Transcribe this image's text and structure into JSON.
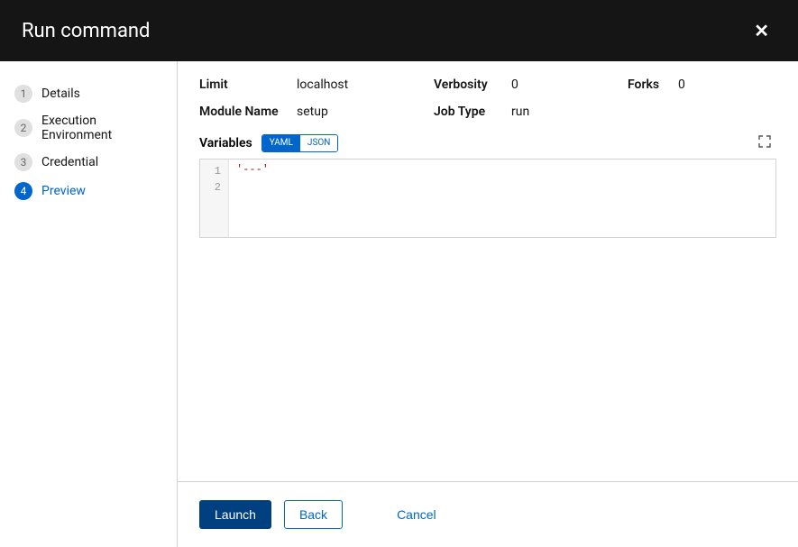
{
  "header": {
    "title": "Run command"
  },
  "steps": [
    {
      "num": "1",
      "label": "Details"
    },
    {
      "num": "2",
      "label": "Execution Environment"
    },
    {
      "num": "3",
      "label": "Credential"
    },
    {
      "num": "4",
      "label": "Preview"
    }
  ],
  "details": {
    "limit_label": "Limit",
    "limit_value": "localhost",
    "verbosity_label": "Verbosity",
    "verbosity_value": "0",
    "forks_label": "Forks",
    "forks_value": "0",
    "module_label": "Module Name",
    "module_value": "setup",
    "jobtype_label": "Job Type",
    "jobtype_value": "run"
  },
  "variables": {
    "label": "Variables",
    "toggle_yaml": "YAML",
    "toggle_json": "JSON",
    "code_line1": "'---'",
    "gutter1": "1",
    "gutter2": "2"
  },
  "footer": {
    "launch": "Launch",
    "back": "Back",
    "cancel": "Cancel"
  }
}
